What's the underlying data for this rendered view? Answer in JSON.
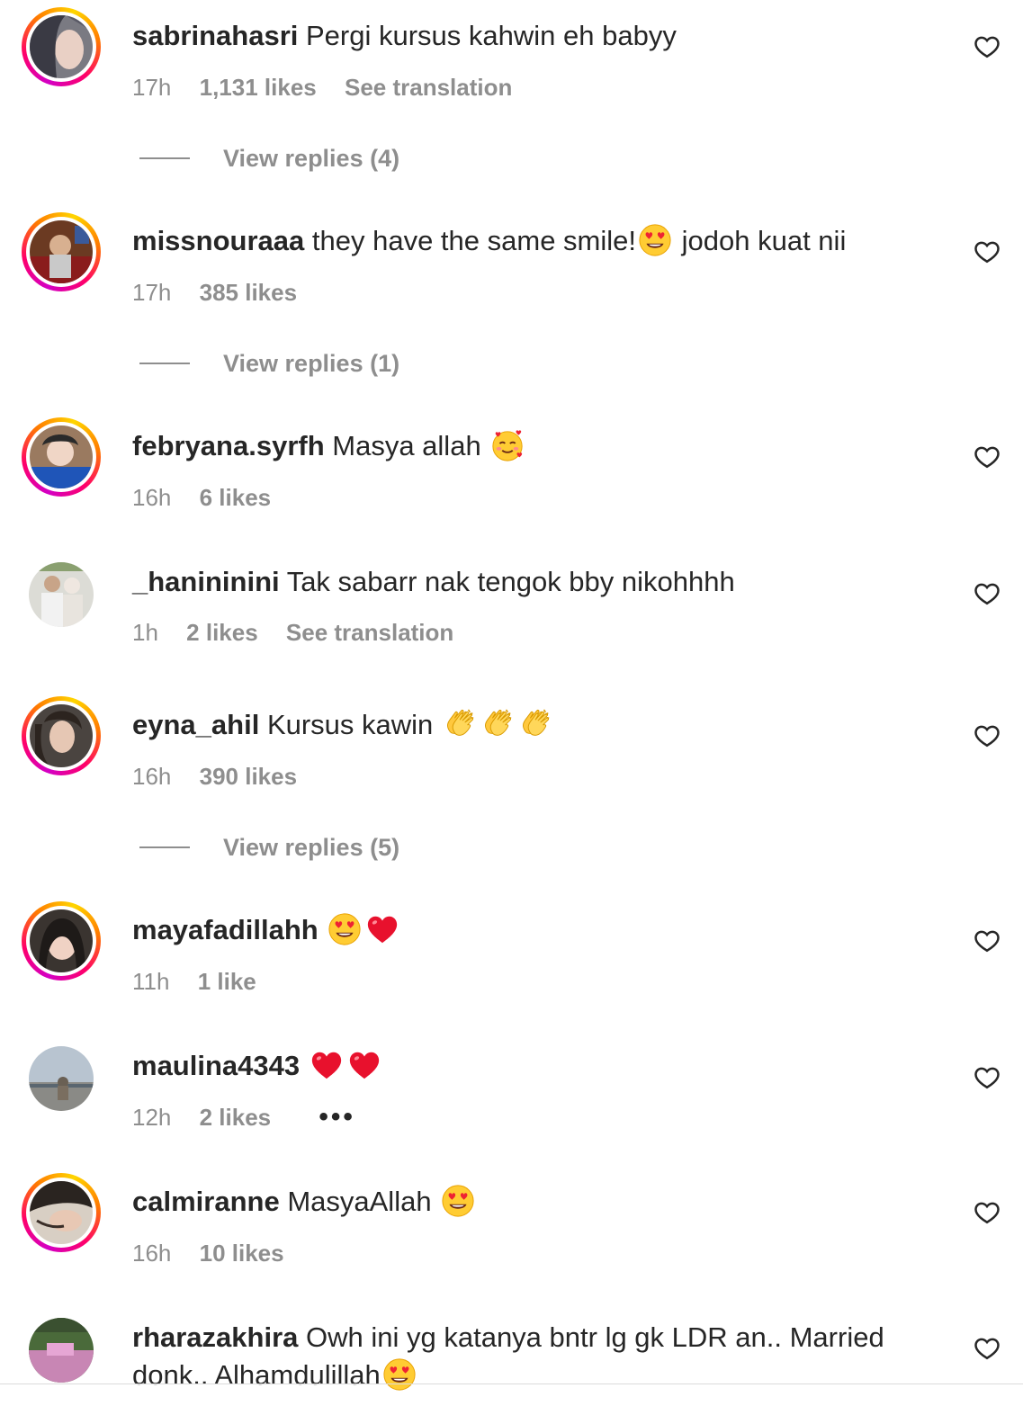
{
  "icons": {
    "like": "heart-outline-icon",
    "more": "more-options-icon"
  },
  "colors": {
    "text": "#262626",
    "secondary": "#8e8e8e",
    "ring_gradient": [
      "#d300c5",
      "#ff0069",
      "#ff7a00",
      "#ffd600"
    ]
  },
  "comments": [
    {
      "username": "sabrinahasri",
      "text": "Pergi kursus kahwin eh babyy",
      "emoji_after": [],
      "trailing_text": "",
      "time": "17h",
      "likes": "1,131 likes",
      "translation": "See translation",
      "replies": "View replies (4)",
      "story_ring": true
    },
    {
      "username": "missnouraaa",
      "text": "they have the same smile!",
      "emoji_after": [
        "heart-eyes-emoji"
      ],
      "trailing_text": "jodoh kuat nii",
      "time": "17h",
      "likes": "385 likes",
      "translation": "",
      "replies": "View replies (1)",
      "story_ring": true
    },
    {
      "username": "febryana.syrfh",
      "text": "Masya allah",
      "emoji_after": [
        "smiling-face-with-hearts-emoji"
      ],
      "trailing_text": "",
      "time": "16h",
      "likes": "6 likes",
      "translation": "",
      "replies": "",
      "story_ring": true
    },
    {
      "username": "_hanininini",
      "text": "Tak sabarr nak tengok bby nikohhhh",
      "emoji_after": [],
      "trailing_text": "",
      "time": "1h",
      "likes": "2 likes",
      "translation": "See translation",
      "replies": "",
      "story_ring": false
    },
    {
      "username": "eyna_ahil",
      "text": "Kursus kawin",
      "emoji_after": [
        "clapping-hands-emoji",
        "clapping-hands-emoji",
        "clapping-hands-emoji"
      ],
      "trailing_text": "",
      "time": "16h",
      "likes": "390 likes",
      "translation": "",
      "replies": "View replies (5)",
      "story_ring": true
    },
    {
      "username": "mayafadillahh",
      "text": "",
      "emoji_after": [
        "heart-eyes-emoji",
        "red-heart-emoji"
      ],
      "trailing_text": "",
      "time": "11h",
      "likes": "1 like",
      "translation": "",
      "replies": "",
      "story_ring": true
    },
    {
      "username": "maulina4343",
      "text": "",
      "emoji_after": [
        "red-heart-emoji",
        "red-heart-emoji"
      ],
      "trailing_text": "",
      "time": "12h",
      "likes": "2 likes",
      "translation": "",
      "replies": "",
      "more": "•••",
      "story_ring": false
    },
    {
      "username": "calmiranne",
      "text": "MasyaAllah",
      "emoji_after": [
        "heart-eyes-emoji"
      ],
      "trailing_text": "",
      "time": "16h",
      "likes": "10 likes",
      "translation": "",
      "replies": "",
      "story_ring": true
    },
    {
      "username": "rharazakhira",
      "text": "Owh ini yg katanya bntr lg gk LDR an.. Married donk.. Alhamdulillah",
      "emoji_after": [
        "heart-eyes-emoji"
      ],
      "trailing_text": "",
      "time": "",
      "likes": "",
      "translation": "",
      "replies": "",
      "story_ring": false
    }
  ]
}
